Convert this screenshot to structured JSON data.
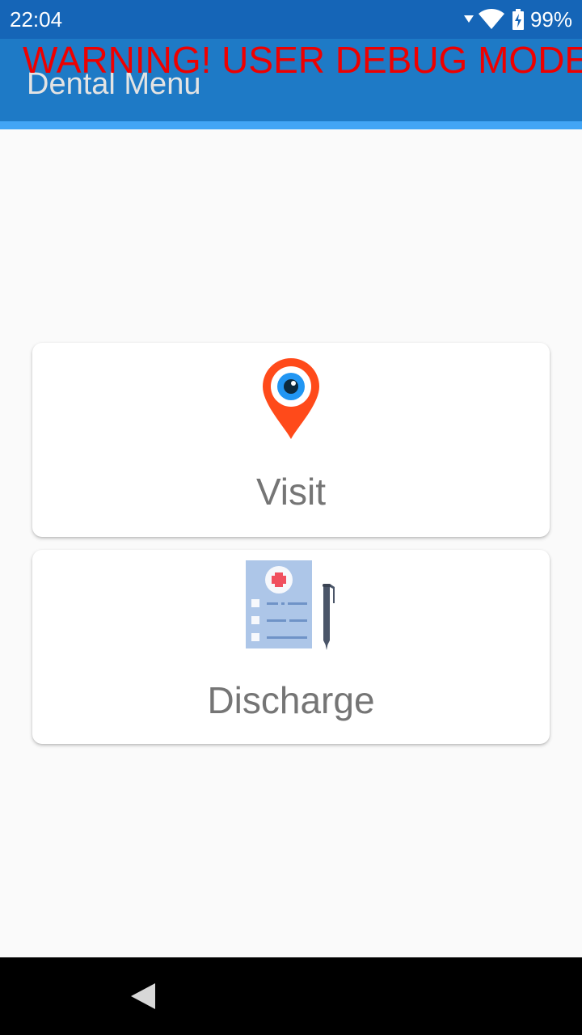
{
  "status_bar": {
    "time": "22:04",
    "battery_percent": "99%",
    "icons": [
      "data-arrow-icon",
      "wifi-icon",
      "battery-charging-icon"
    ]
  },
  "app_bar": {
    "title": "Dental Menu",
    "debug_warning": "WARNING! USER DEBUG MODE"
  },
  "menu": {
    "items": [
      {
        "label": "Visit",
        "icon": "location-pin-eye-icon"
      },
      {
        "label": "Discharge",
        "icon": "medical-form-pen-icon"
      }
    ]
  },
  "nav_bar": {
    "icons": [
      "back-icon"
    ]
  },
  "colors": {
    "status_bar": "#1565b7",
    "app_bar": "#1e7ac6",
    "app_bar_accent": "#42a5f5",
    "warning_text": "#ee0000",
    "pin_orange": "#ff4a1a",
    "eye_blue": "#2196f3",
    "card_label": "#757575"
  }
}
